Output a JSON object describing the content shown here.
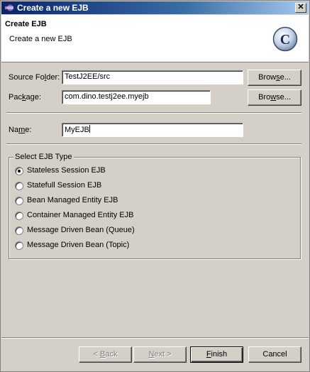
{
  "window": {
    "title": "Create a new EJB",
    "close_glyph": "✕"
  },
  "banner": {
    "title": "Create EJB",
    "description": "Create a new EJB",
    "logo_letter": "C"
  },
  "source_folder": {
    "label_pre": "Source Fo",
    "label_mnemonic": "l",
    "label_post": "der:",
    "value": "TestJ2EE/src",
    "browse_pre": "Brow",
    "browse_mnemonic": "s",
    "browse_post": "e..."
  },
  "package": {
    "label_pre": "Pac",
    "label_mnemonic": "k",
    "label_post": "age:",
    "value": "com.dino.testj2ee.myejb",
    "browse_pre": "Bro",
    "browse_mnemonic": "w",
    "browse_post": "se..."
  },
  "name": {
    "label_pre": "Na",
    "label_mnemonic": "m",
    "label_post": "e:",
    "value": "MyEJB"
  },
  "ejb_type": {
    "legend": "Select EJB Type",
    "selected_index": 0,
    "options": [
      "Stateless Session EJB",
      "Statefull Session EJB",
      "Bean Managed Entity EJB",
      "Container Managed Entity EJB",
      "Message Driven Bean (Queue)",
      "Message Driven Bean (Topic)"
    ]
  },
  "buttons": {
    "back_pre": "< ",
    "back_mnemonic": "B",
    "back_post": "ack",
    "next_mnemonic": "N",
    "next_post": "ext >",
    "finish_mnemonic": "F",
    "finish_post": "inish",
    "cancel": "Cancel"
  }
}
